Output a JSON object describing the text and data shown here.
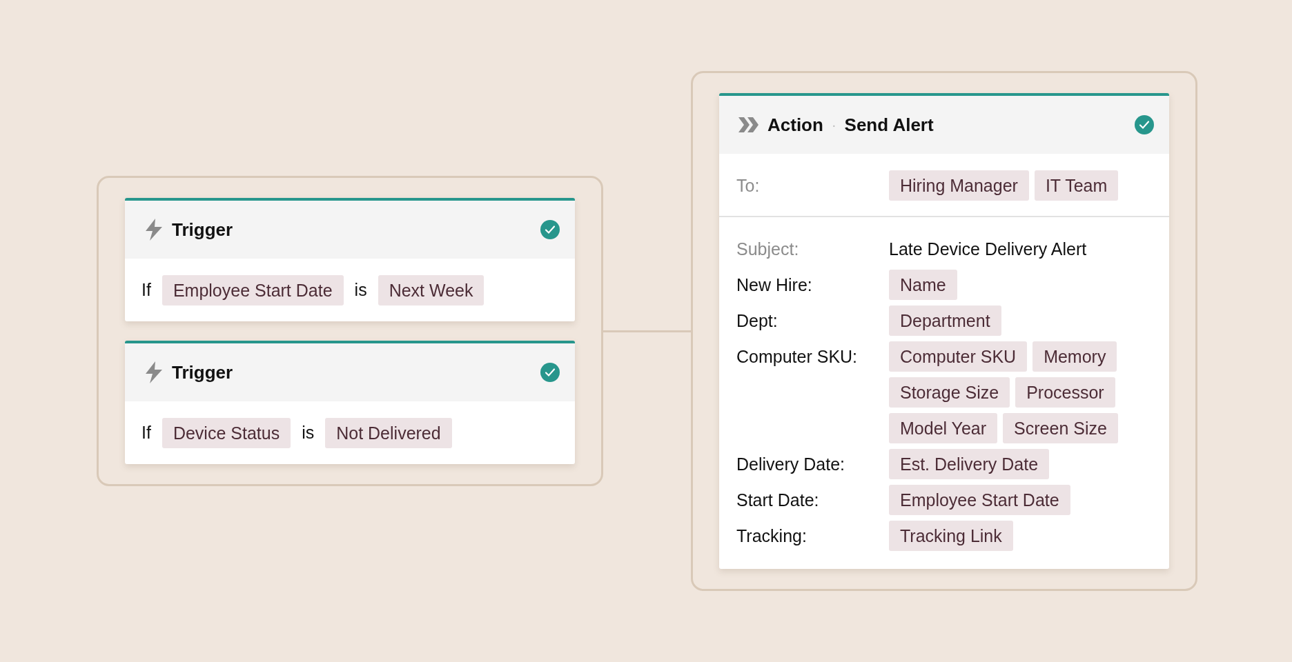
{
  "triggers": [
    {
      "title": "Trigger",
      "complete": true,
      "condition": {
        "if": "If",
        "field": "Employee Start Date",
        "operator": "is",
        "value": "Next Week"
      }
    },
    {
      "title": "Trigger",
      "complete": true,
      "condition": {
        "if": "If",
        "field": "Device Status",
        "operator": "is",
        "value": "Not Delivered"
      }
    }
  ],
  "action": {
    "type": "Action",
    "separator": "·",
    "name": "Send Alert",
    "complete": true,
    "to": {
      "label": "To:",
      "tokens": [
        "Hiring Manager",
        "IT Team"
      ]
    },
    "fields": [
      {
        "label": "Subject:",
        "muted": true,
        "kind": "text",
        "value": "Late Device Delivery Alert"
      },
      {
        "label": "New Hire:",
        "muted": false,
        "kind": "tokens",
        "tokens": [
          "Name"
        ]
      },
      {
        "label": "Dept:",
        "muted": false,
        "kind": "tokens",
        "tokens": [
          "Department"
        ]
      },
      {
        "label": "Computer SKU:",
        "muted": false,
        "kind": "tokens",
        "tokens": [
          "Computer SKU",
          "Memory",
          "Storage Size",
          "Processor",
          "Model Year",
          "Screen Size"
        ]
      },
      {
        "label": "Delivery Date:",
        "muted": false,
        "kind": "tokens",
        "tokens": [
          "Est. Delivery Date"
        ]
      },
      {
        "label": "Start Date:",
        "muted": false,
        "kind": "tokens",
        "tokens": [
          "Employee Start Date"
        ]
      },
      {
        "label": "Tracking:",
        "muted": false,
        "kind": "tokens",
        "tokens": [
          "Tracking Link"
        ]
      }
    ]
  }
}
